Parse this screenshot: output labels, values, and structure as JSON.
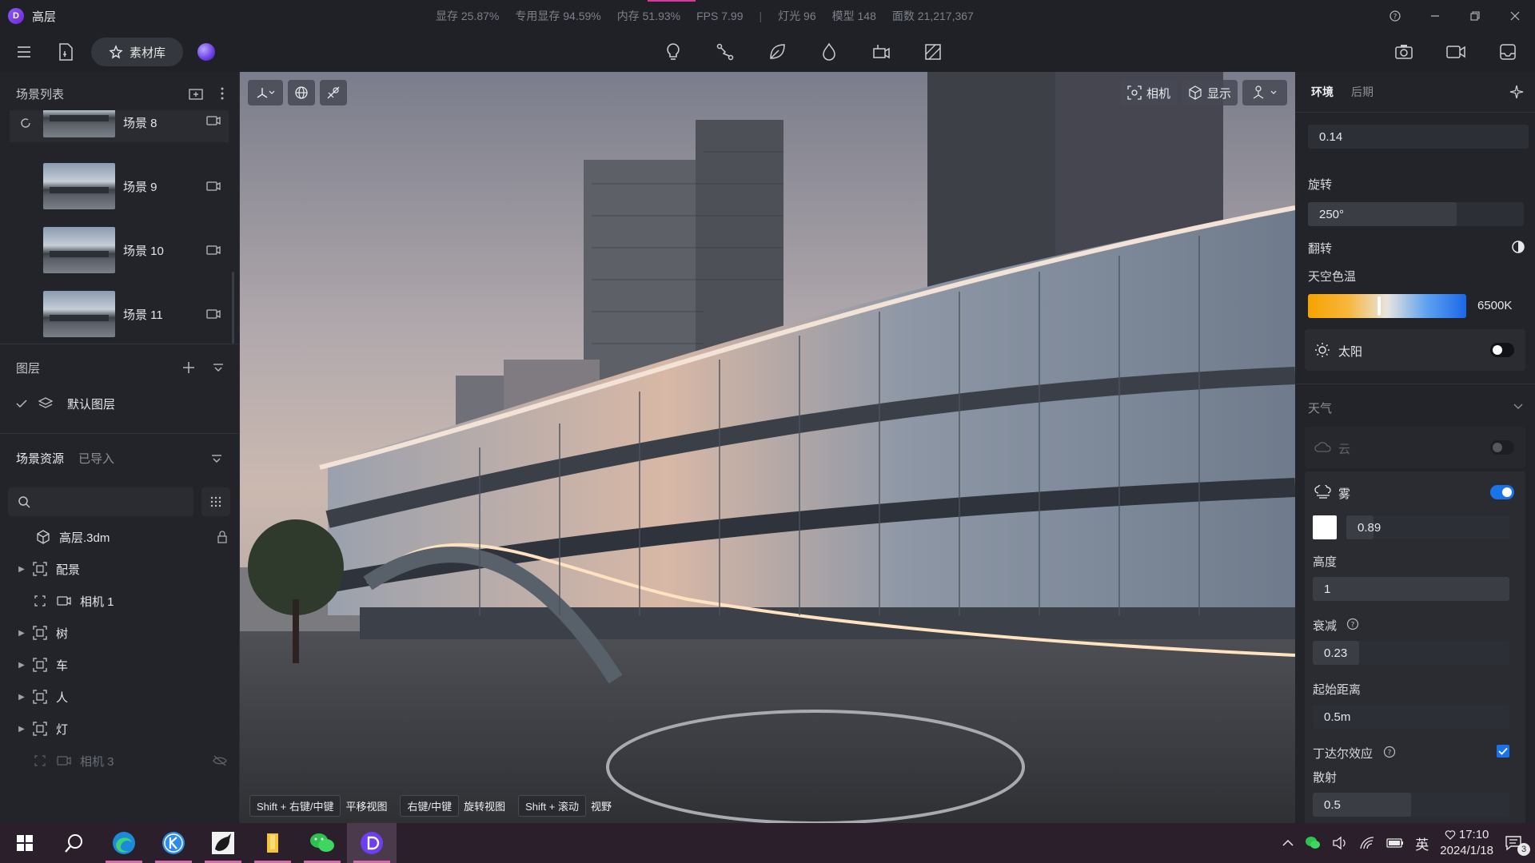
{
  "window": {
    "title": "高层",
    "logo_letter": "D"
  },
  "stats": {
    "vram": "显存 25.87%",
    "dedicated_vram": "专用显存 94.59%",
    "memory": "内存 51.93%",
    "fps": "FPS 7.99",
    "separator": "|",
    "lights": "灯光 96",
    "models": "模型 148",
    "faces": "面数 21,217,367"
  },
  "toolbar": {
    "material_library": "素材库"
  },
  "scene_list": {
    "title": "场景列表",
    "scenes": [
      {
        "name": "场景 8"
      },
      {
        "name": "场景 9"
      },
      {
        "name": "场景 10"
      },
      {
        "name": "场景 11"
      }
    ]
  },
  "layers": {
    "title": "图层",
    "default_layer": "默认图层"
  },
  "assets": {
    "tab_scene_assets": "场景资源",
    "tab_imported": "已导入",
    "tree": [
      {
        "label": "高层.3dm",
        "icon": "model-cube-icon"
      },
      {
        "label": "配景",
        "icon": "group-icon"
      },
      {
        "label": "相机 1",
        "icon": "camera-icon"
      },
      {
        "label": "树",
        "icon": "group-icon"
      },
      {
        "label": "车",
        "icon": "group-icon"
      },
      {
        "label": "人",
        "icon": "group-icon"
      },
      {
        "label": "灯",
        "icon": "group-icon"
      },
      {
        "label": "相机 3",
        "icon": "camera-icon"
      }
    ]
  },
  "viewport": {
    "camera_btn": "相机",
    "display_btn": "显示",
    "hints": [
      {
        "key": "Shift + 右键/中键",
        "label": "平移视图"
      },
      {
        "key": "右键/中键",
        "label": "旋转视图"
      },
      {
        "key": "Shift + 滚动",
        "label": "视野"
      }
    ]
  },
  "right_panel": {
    "tab_environment": "环境",
    "tab_post": "后期",
    "top_value": "0.14",
    "rotation_label": "旋转",
    "rotation_value": "250°",
    "rotation_fraction": 0.69,
    "flip_label": "翻转",
    "sky_temp_label": "天空色温",
    "sky_temp_value": "6500K",
    "sun_label": "太阳",
    "weather_label": "天气",
    "cloud_label": "云",
    "fog_label": "雾",
    "fog_value": "0.89",
    "height_label": "高度",
    "height_value": "1",
    "decay_label": "衰减",
    "decay_value": "0.23",
    "start_distance_label": "起始距离",
    "start_distance_value": "0.5m",
    "tyndall_label": "丁达尔效应",
    "scatter_label": "散射",
    "scatter_value": "0.5",
    "colors": {
      "accent_blue": "#1a73e8",
      "fog_swatch": "#ffffff"
    }
  },
  "taskbar": {
    "time": "17:10",
    "date": "2024/1/18",
    "ime": "英",
    "notifications": "3"
  }
}
